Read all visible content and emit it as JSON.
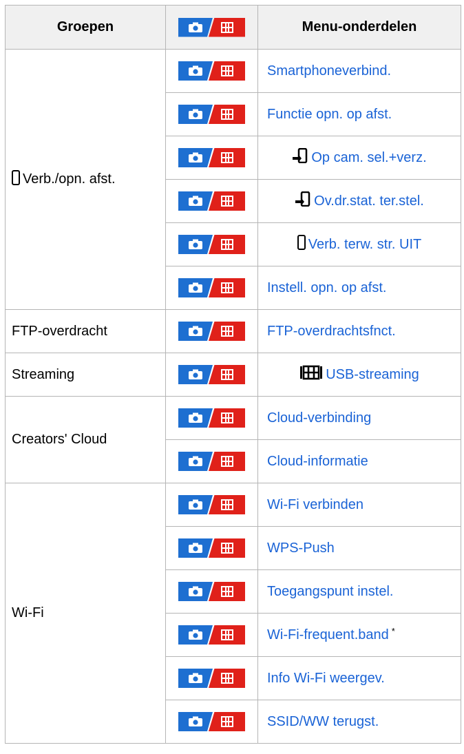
{
  "header": {
    "groups": "Groepen",
    "menu_items": "Menu-onderdelen"
  },
  "badge": {
    "photo_icon": "camera-icon",
    "movie_icon": "film-icon",
    "photo_color": "#1e6fd1",
    "movie_color": "#e0211a"
  },
  "link_color": "#1a63d6",
  "groups": [
    {
      "name": "Verb./opn. afst.",
      "icon": "smartphone-icon",
      "items": [
        {
          "label": "Smartphoneverbind."
        },
        {
          "label": "Functie opn. op afst."
        },
        {
          "label": "Op cam. sel.+verz.",
          "icon": "send-to-smartphone-icon"
        },
        {
          "label": "Ov.dr.stat. ter.stel.",
          "icon": "send-to-smartphone-icon"
        },
        {
          "label": "Verb. terw. str. UIT",
          "icon": "smartphone-icon"
        },
        {
          "label": "Instell. opn. op afst."
        }
      ]
    },
    {
      "name": "FTP-overdracht",
      "items": [
        {
          "label": "FTP-overdrachtsfnct."
        }
      ]
    },
    {
      "name": "Streaming",
      "items": [
        {
          "label": "USB-streaming",
          "icon": "film-icon"
        }
      ]
    },
    {
      "name": "Creators' Cloud",
      "items": [
        {
          "label": "Cloud-verbinding"
        },
        {
          "label": "Cloud-informatie"
        }
      ]
    },
    {
      "name": "Wi-Fi",
      "items": [
        {
          "label": "Wi-Fi verbinden"
        },
        {
          "label": "WPS-Push"
        },
        {
          "label": "Toegangspunt instel."
        },
        {
          "label": "Wi-Fi-frequent.band",
          "footnote": "*"
        },
        {
          "label": "Info Wi-Fi weergev."
        },
        {
          "label": "SSID/WW terugst."
        }
      ]
    }
  ]
}
